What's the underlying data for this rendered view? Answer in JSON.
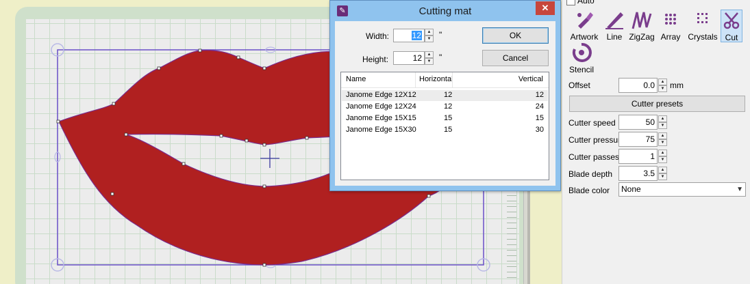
{
  "dialog": {
    "title": "Cutting mat",
    "close_glyph": "✕",
    "icon": "artwork-icon",
    "width_label": "Width:",
    "width_value": "12",
    "width_unit": "\"",
    "height_label": "Height:",
    "height_value": "12",
    "height_unit": "\"",
    "ok_label": "OK",
    "cancel_label": "Cancel",
    "columns": [
      "Name",
      "Horizontal",
      "Vertical"
    ],
    "rows": [
      {
        "name": "Janome Edge 12X12",
        "horizontal": "12",
        "vertical": "12"
      },
      {
        "name": "Janome Edge 12X24",
        "horizontal": "12",
        "vertical": "24"
      },
      {
        "name": "Janome Edge 15X15",
        "horizontal": "15",
        "vertical": "15"
      },
      {
        "name": "Janome Edge 15X30",
        "horizontal": "15",
        "vertical": "30"
      }
    ]
  },
  "panel": {
    "auto_label": "Auto",
    "tools": [
      {
        "label": "Artwork",
        "icon": "artwork-brush-icon"
      },
      {
        "label": "Line",
        "icon": "line-pen-icon"
      },
      {
        "label": "ZigZag",
        "icon": "zigzag-icon"
      },
      {
        "label": "Array",
        "icon": "array-dots-icon"
      },
      {
        "label": "Crystals",
        "icon": "crystals-icon"
      },
      {
        "label": "Cut",
        "icon": "scissors-icon",
        "active": true
      },
      {
        "label": "Stencil",
        "icon": "stencil-icon"
      }
    ],
    "offset_label": "Offset",
    "offset_value": "0.0",
    "offset_unit": "mm",
    "presets_label": "Cutter presets",
    "speed_label": "Cutter speed",
    "speed_value": "50",
    "pressure_label": "Cutter pressure",
    "pressure_value": "75",
    "passes_label": "Cutter passes",
    "passes_value": "1",
    "depth_label": "Blade depth",
    "depth_value": "3.5",
    "color_label": "Blade color",
    "color_value": "None"
  },
  "colors": {
    "lips_fill": "#b02020",
    "selection_outline": "#6a4fc8",
    "active_tool_bg": "#cde3f7",
    "dialog_titlebar": "#8fc3ee"
  }
}
